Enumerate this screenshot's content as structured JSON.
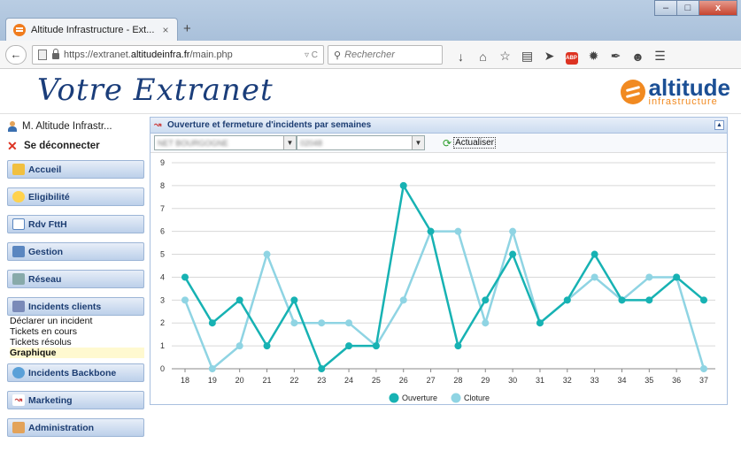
{
  "browser": {
    "tab_title": "Altitude Infrastructure - Ext...",
    "tab_close": "×",
    "new_tab": "+",
    "url_prefix": "https://extranet.",
    "url_domain": "altitudeinfra.fr",
    "url_path": "/main.php",
    "url_controls": "▿ C",
    "search_placeholder": "Rechercher",
    "window_buttons": [
      "–",
      "□",
      "x"
    ]
  },
  "header": {
    "title": "Votre Extranet",
    "logo_word": "altitude",
    "logo_sub": "infrastructure"
  },
  "sidebar": {
    "user": "M. Altitude Infrastr...",
    "logout": "Se déconnecter",
    "menu": [
      {
        "label": "Accueil",
        "icon": "home-icon"
      },
      {
        "label": "Eligibilité",
        "icon": "sun-icon"
      },
      {
        "label": "Rdv FttH",
        "icon": "calendar-icon"
      },
      {
        "label": "Gestion",
        "icon": "document-icon"
      },
      {
        "label": "Réseau",
        "icon": "network-icon"
      },
      {
        "label": "Incidents clients",
        "icon": "tool-icon"
      },
      {
        "label": "Incidents Backbone",
        "icon": "backbone-icon"
      },
      {
        "label": "Marketing",
        "icon": "marketing-icon"
      },
      {
        "label": "Administration",
        "icon": "admin-icon"
      }
    ],
    "submenu": [
      "Déclarer un incident",
      "Tickets en cours",
      "Tickets résolus",
      "Graphique"
    ]
  },
  "panel": {
    "title": "Ouverture et fermeture d'incidents par semaines",
    "select1": "NET BOURGOGNE",
    "select2": "02048",
    "refresh": "Actualiser"
  },
  "colors": {
    "ouverture": "#17b2b3",
    "cloture": "#8fd4e3"
  },
  "chart_data": {
    "type": "line",
    "x": [
      "18",
      "19",
      "20",
      "21",
      "22",
      "23",
      "24",
      "25",
      "26",
      "27",
      "28",
      "29",
      "30",
      "31",
      "32",
      "33",
      "34",
      "35",
      "36",
      "37"
    ],
    "series": [
      {
        "name": "Ouverture",
        "values": [
          4,
          2,
          3,
          1,
          3,
          0,
          1,
          1,
          8,
          6,
          1,
          3,
          5,
          2,
          3,
          5,
          3,
          3,
          4,
          3
        ]
      },
      {
        "name": "Cloture",
        "values": [
          3,
          0,
          1,
          5,
          2,
          2,
          2,
          1,
          3,
          6,
          6,
          2,
          6,
          2,
          3,
          4,
          3,
          4,
          4,
          0
        ]
      }
    ],
    "ylim": [
      0,
      9
    ],
    "yticks": [
      "0",
      "1",
      "2",
      "3",
      "4",
      "5",
      "6",
      "7",
      "8",
      "9"
    ],
    "grid": true,
    "legend": "bottom"
  }
}
